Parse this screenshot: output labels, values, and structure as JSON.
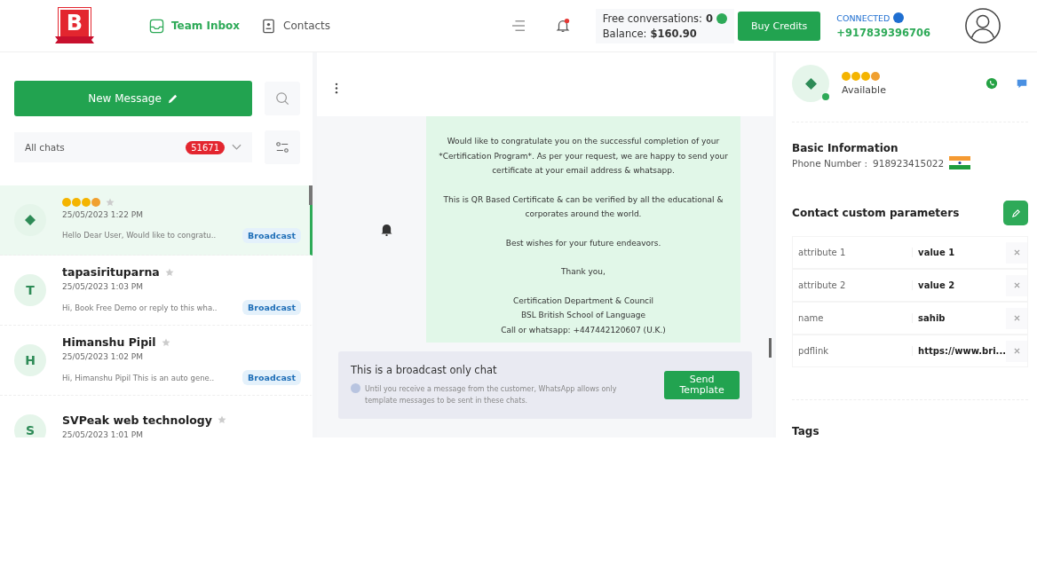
{
  "header": {
    "logo": "B",
    "nav": [
      {
        "label": "Team Inbox",
        "selected": true,
        "kind": "inbox"
      },
      {
        "label": "Contacts",
        "selected": false,
        "kind": "contacts"
      }
    ],
    "notification": {
      "unread": true
    },
    "credits": {
      "free_label": "Free conversations:",
      "free_value": "0",
      "balance_label": "Balance:",
      "balance_value": "$160.90"
    },
    "buy_button": "Buy Credits",
    "connection": {
      "status": "CONNECTED",
      "number": "+917839396706"
    }
  },
  "sidebar": {
    "new_message": "New Message",
    "filter": {
      "label": "All chats",
      "count": "51671"
    },
    "chats": [
      {
        "kind": "glyph",
        "emoji_name": true,
        "time": "25/05/2023 1:22 PM",
        "preview": "Hello Dear User, Would like to congratu..",
        "badge": "Broadcast",
        "selected": true
      },
      {
        "kind": "letter",
        "avatar": "T",
        "emoji_name": false,
        "name": "tapasirituparna",
        "time": "25/05/2023 1:03 PM",
        "preview": "Hi, Book Free Demo or reply to this wha..",
        "badge": "Broadcast",
        "selected": false
      },
      {
        "kind": "letter",
        "avatar": "H",
        "emoji_name": false,
        "name": "Himanshu Pipil",
        "time": "25/05/2023 1:02 PM",
        "preview": "Hi, Himanshu Pipil This is an auto gene..",
        "badge": "Broadcast",
        "selected": false
      },
      {
        "kind": "letter",
        "avatar": "S",
        "emoji_name": false,
        "name": "SVPeak web technology",
        "time": "25/05/2023 1:01 PM",
        "selected": false
      }
    ]
  },
  "conversation": {
    "message": {
      "paragraphs": [
        [
          "Would like to congratulate you on the successful completion of your *Certification Program*. As per your request, we are happy to send your certificate at your email address & whatsapp."
        ],
        [
          "This is QR Based Certificate & can be verified by all the educational & corporates around the world."
        ],
        [
          "Best wishes for your future endeavors."
        ],
        [
          "Thank you,"
        ],
        [
          "Certification Department & Council",
          "BSL British School of Language",
          "Call or whatsapp: +447442120607 (U.K.)"
        ]
      ]
    },
    "notice": {
      "title": "This is a broadcast only chat",
      "text": "Until you receive a message from the customer, WhatsApp allows only template messages to be sent in these chats.",
      "button": "Send Template"
    }
  },
  "contact": {
    "avatar_glyph": true,
    "online": true,
    "status": "Available",
    "basic_title": "Basic Information",
    "phone_label": "Phone Number :",
    "phone": "918923415022",
    "params_title": "Contact custom parameters",
    "params": [
      {
        "key": "attribute 1",
        "value": "value 1"
      },
      {
        "key": "attribute 2",
        "value": "value 2"
      },
      {
        "key": "name",
        "value": "sahib"
      },
      {
        "key": "pdflink",
        "value": "https://www.bri..."
      }
    ],
    "tags_title": "Tags"
  }
}
